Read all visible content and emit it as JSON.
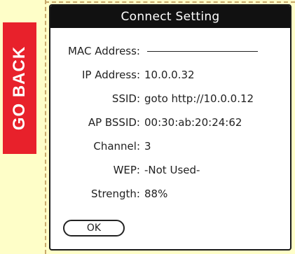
{
  "go_back": {
    "label": "GO BACK"
  },
  "dialog": {
    "title": "Connect Setting",
    "fields": {
      "mac_address": {
        "label": "MAC Address:",
        "value": ""
      },
      "ip_address": {
        "label": "IP Address:",
        "value": "10.0.0.32"
      },
      "ssid": {
        "label": "SSID:",
        "value": "goto http://10.0.0.12"
      },
      "ap_bssid": {
        "label": "AP BSSID:",
        "value": "00:30:ab:20:24:62"
      },
      "channel": {
        "label": "Channel:",
        "value": "3"
      },
      "wep": {
        "label": "WEP:",
        "value": "-Not Used-"
      },
      "strength": {
        "label": "Strength:",
        "value": "88%"
      }
    },
    "ok_label": "OK"
  },
  "colors": {
    "page_background": "#fefec8",
    "go_back_background": "#e8212b",
    "title_bar": "#111111",
    "dashed_border": "#c8a86a"
  }
}
